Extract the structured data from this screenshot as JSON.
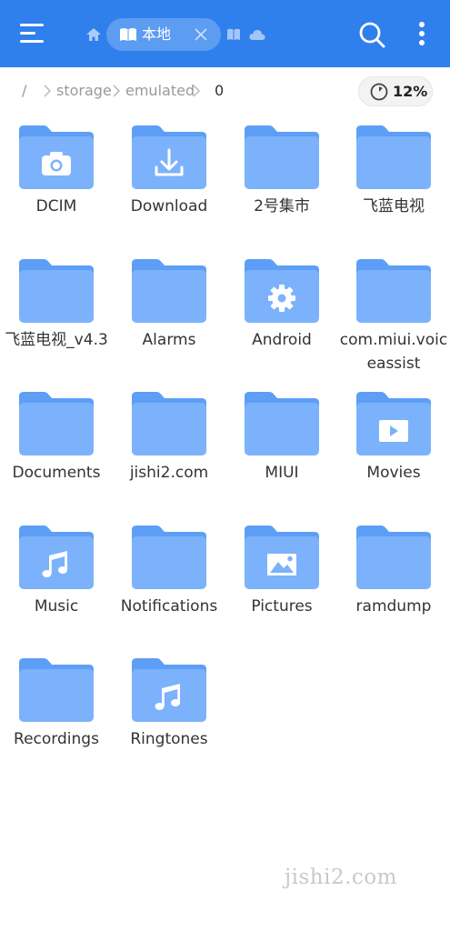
{
  "header": {
    "tab_label": "本地",
    "icons": [
      "menu-icon",
      "home-icon",
      "book-icon",
      "close-icon",
      "book-icon",
      "cloud-icon",
      "search-icon",
      "more-vert-icon"
    ]
  },
  "breadcrumb": {
    "root": "/",
    "segments": [
      "storage",
      "emulated"
    ],
    "current": "0"
  },
  "storage": {
    "percent_label": "12%",
    "percent_used": 12
  },
  "files": [
    {
      "name": "DCIM",
      "icon": "camera-icon"
    },
    {
      "name": "Download",
      "icon": "download-icon"
    },
    {
      "name": "2号集市",
      "icon": "folder-icon"
    },
    {
      "name": "飞蓝电视",
      "icon": "folder-icon"
    },
    {
      "name": "飞蓝电视_v4.3",
      "icon": "folder-icon"
    },
    {
      "name": "Alarms",
      "icon": "folder-icon"
    },
    {
      "name": "Android",
      "icon": "gear-icon"
    },
    {
      "name": "com.miui.voiceassist",
      "icon": "folder-icon"
    },
    {
      "name": "Documents",
      "icon": "folder-icon"
    },
    {
      "name": "jishi2.com",
      "icon": "folder-icon"
    },
    {
      "name": "MIUI",
      "icon": "folder-icon"
    },
    {
      "name": "Movies",
      "icon": "play-icon"
    },
    {
      "name": "Music",
      "icon": "music-note-icon"
    },
    {
      "name": "Notifications",
      "icon": "folder-icon"
    },
    {
      "name": "Pictures",
      "icon": "image-icon"
    },
    {
      "name": "ramdump",
      "icon": "folder-icon"
    },
    {
      "name": "Recordings",
      "icon": "folder-icon"
    },
    {
      "name": "Ringtones",
      "icon": "music-note-icon"
    }
  ],
  "watermark": "jishi2.com",
  "colors": {
    "header": "#2f80ed",
    "folder_back": "#5d9ef6",
    "folder_front": "#7cb2fb"
  }
}
